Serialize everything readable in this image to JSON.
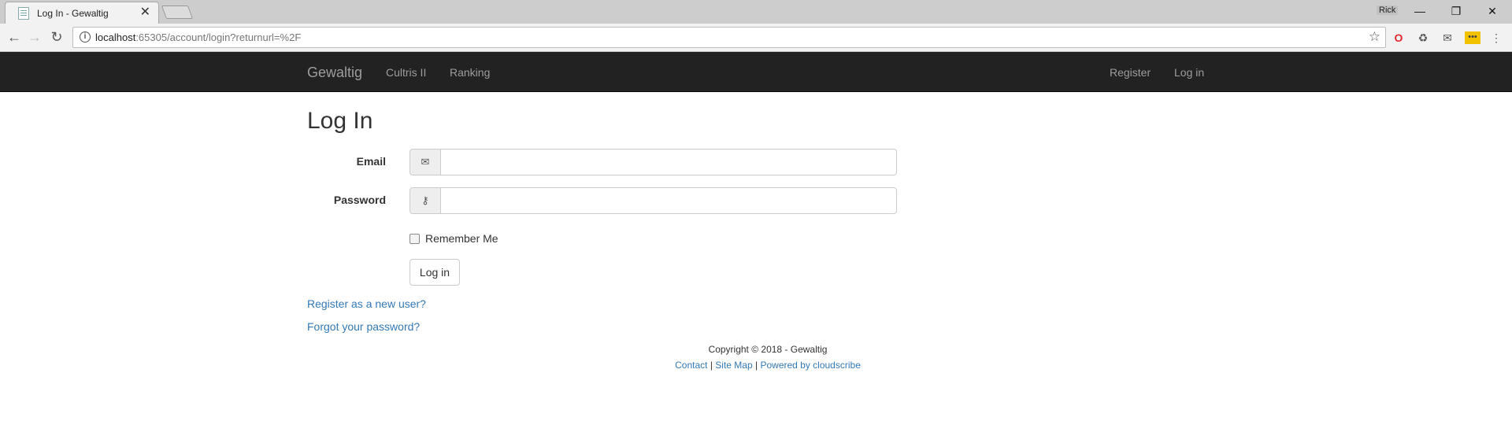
{
  "browser": {
    "tab_title": "Log In - Gewaltig",
    "tab_close": "✕",
    "profile_name": "Rick",
    "url_host": "localhost",
    "url_rest": ":65305/account/login?returnurl=%2F"
  },
  "navbar": {
    "brand": "Gewaltig",
    "left_links": [
      "Cultris II",
      "Ranking"
    ],
    "right_links": [
      "Register",
      "Log in"
    ]
  },
  "form": {
    "heading": "Log In",
    "email_label": "Email",
    "email_value": "",
    "password_label": "Password",
    "password_value": "",
    "remember_label": "Remember Me",
    "submit_label": "Log in",
    "register_link": "Register as a new user?",
    "forgot_link": "Forgot your password?"
  },
  "footer": {
    "copyright": "Copyright © 2018 - Gewaltig",
    "contact": "Contact",
    "sitemap": "Site Map",
    "powered": "Powered by cloudscribe",
    "separator": "|"
  },
  "colors": {
    "navbar_bg": "#222222",
    "link": "#337ab7"
  }
}
